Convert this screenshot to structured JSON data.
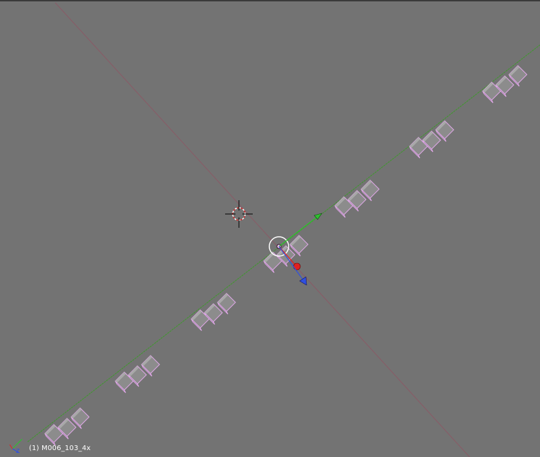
{
  "viewport": {
    "object_label": "(1) M006_103_4x",
    "axis_gizmo_label": "Z",
    "colors": {
      "background": "#737373",
      "x_axis_line": "#8a5a66",
      "y_axis_line": "#3d9a2a",
      "selection_outline": "#e0a8e8",
      "block_face": "#8c8c8c",
      "block_top": "#a8a8a8",
      "block_side": "#595959",
      "manipulator_x": "#e02020",
      "manipulator_y": "#30c030",
      "manipulator_z": "#3050e0"
    }
  }
}
